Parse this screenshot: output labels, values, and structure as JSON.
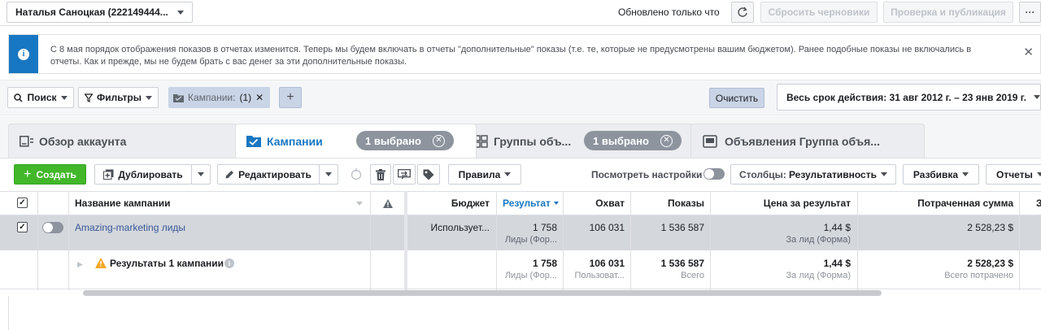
{
  "topbar": {
    "account_name": "Наталья Саноцкая (222149444...",
    "updated_text": "Обновлено только что",
    "discard_drafts": "Сбросить черновики",
    "review_publish": "Проверка и публикация",
    "more": "···"
  },
  "banner": {
    "text": "С 8 мая порядок отображения показов в отчетах изменится. Теперь мы будем включать в отчеты \"дополнительные\" показы (т.е. те, которые не предусмотрены вашим бюджетом). Ранее подобные показы не включались в отчеты. Как и прежде, мы не будем брать с вас денег за эти дополнительные показы.",
    "close": "✕"
  },
  "filters": {
    "search": "Поиск",
    "filters": "Фильтры",
    "chip_label": "Кампании:",
    "chip_value": "(1)",
    "chip_close": "✕",
    "add": "+",
    "clear": "Очистить",
    "date_range": "Весь срок действия: 31 авг 2012 г. – 23 янв 2019 г."
  },
  "tabs": [
    {
      "label": "Обзор аккаунта"
    },
    {
      "label": "Кампании",
      "badge": "1 выбрано"
    },
    {
      "label": "Группы объ...",
      "badge": "1 выбрано"
    },
    {
      "label": "Объявления Группа объя..."
    }
  ],
  "toolbar": {
    "create": "Создать",
    "duplicate": "Дублировать",
    "edit": "Редактировать",
    "rules": "Правила",
    "view_settings": "Посмотреть настройки",
    "columns_label": "Столбцы:",
    "columns_value": "Результативность",
    "breakdown": "Разбивка",
    "reports": "Отчеты"
  },
  "table": {
    "headers": {
      "name": "Название кампании",
      "budget": "Бюджет",
      "results": "Результат",
      "reach": "Охват",
      "impressions": "Показы",
      "cost_per_result": "Цена за результат",
      "amount_spent": "Потраченная сумма",
      "extra": "З"
    },
    "rows": [
      {
        "name": "Amazing-marketing лиды",
        "budget": "Использует...",
        "results": "1 758",
        "results_sub": "Лиды (Фор...",
        "reach": "106 031",
        "impressions": "1 536 587",
        "cost_per_result": "1,44 $",
        "cost_sub": "За лид (Форма)",
        "amount_spent": "2 528,23 $"
      }
    ],
    "totals": {
      "label": "Результаты 1 кампании",
      "results": "1 758",
      "results_sub": "Лиды (Фор...",
      "reach": "106 031",
      "reach_sub": "Пользоват...",
      "impressions": "1 536 587",
      "impressions_sub": "Всего",
      "cost_per_result": "1,44 $",
      "cost_sub": "За лид (Форма)",
      "amount_spent": "2 528,23 $",
      "amount_sub": "Всего потрачено"
    }
  },
  "colors": {
    "accent_blue": "#1877c2",
    "create_green": "#42b72a",
    "link_blue": "#385898",
    "warning_orange": "#f5a623"
  }
}
